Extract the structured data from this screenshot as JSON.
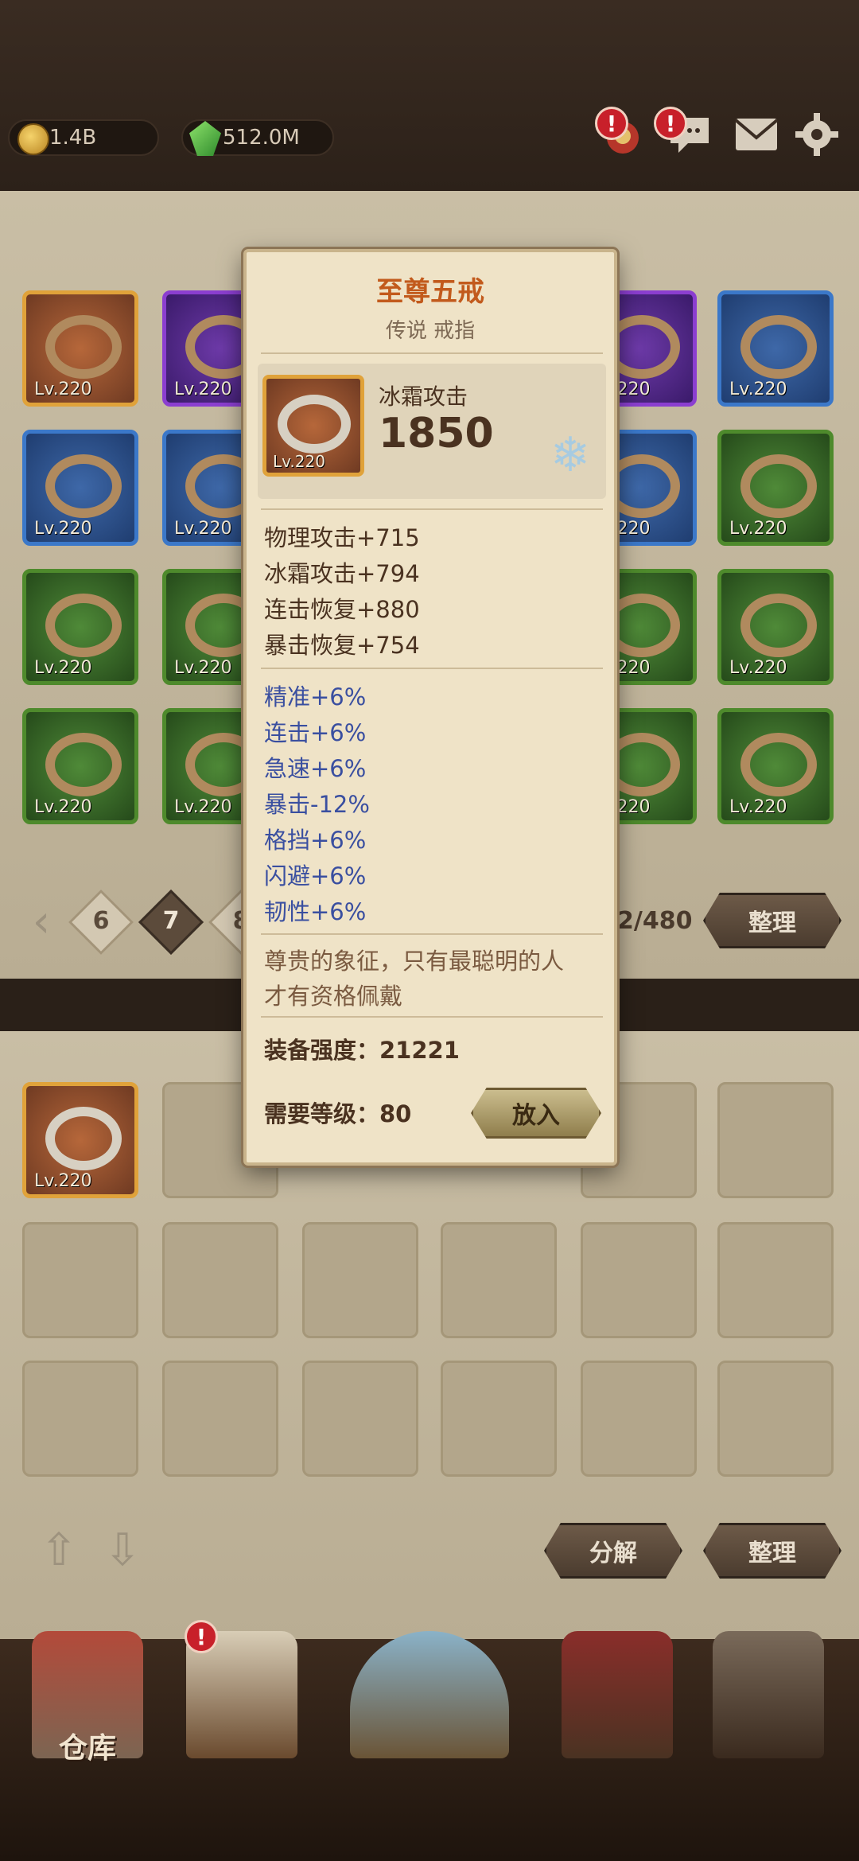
{
  "topbar": {
    "gold": "1.4B",
    "gems": "512.0M",
    "icons": [
      "alert-bag-icon",
      "chat-icon",
      "mail-icon",
      "gear-icon"
    ]
  },
  "grid": {
    "level_label": "Lv.220",
    "rows": [
      [
        "gold",
        "purple",
        "",
        "",
        "blue",
        "blue"
      ],
      [
        "blue",
        "blue",
        "",
        "",
        "blue",
        "green"
      ],
      [
        "green",
        "green",
        "",
        "",
        "green",
        "green"
      ],
      [
        "green",
        "green",
        "",
        "",
        "green",
        "green"
      ]
    ]
  },
  "pager": {
    "pages": [
      "6",
      "7",
      "8"
    ],
    "active": "7",
    "count": "2/480",
    "sort_label": "整理"
  },
  "storage": {
    "level_label": "Lv.220",
    "decompose_label": "分解",
    "sort_label": "整理"
  },
  "nav": {
    "warehouse_label": "仓库"
  },
  "tooltip": {
    "title": "至尊五戒",
    "subtitle": "传说 戒指",
    "main_stat_name": "冰霜攻击",
    "main_stat_value": "1850",
    "item_level": "Lv.220",
    "base_stats": [
      "物理攻击+715",
      "冰霜攻击+794",
      "连击恢复+880",
      "暴击恢复+754"
    ],
    "extra_stats": [
      "精准+6%",
      "连击+6%",
      "急速+6%",
      "暴击-12%",
      "格挡+6%",
      "闪避+6%",
      "韧性+6%"
    ],
    "description_line1": "尊贵的象征，只有最聪明的人",
    "description_line2": "才有资格佩戴",
    "power": "装备强度：21221",
    "required_level": "需要等级：80",
    "put_label": "放入"
  }
}
